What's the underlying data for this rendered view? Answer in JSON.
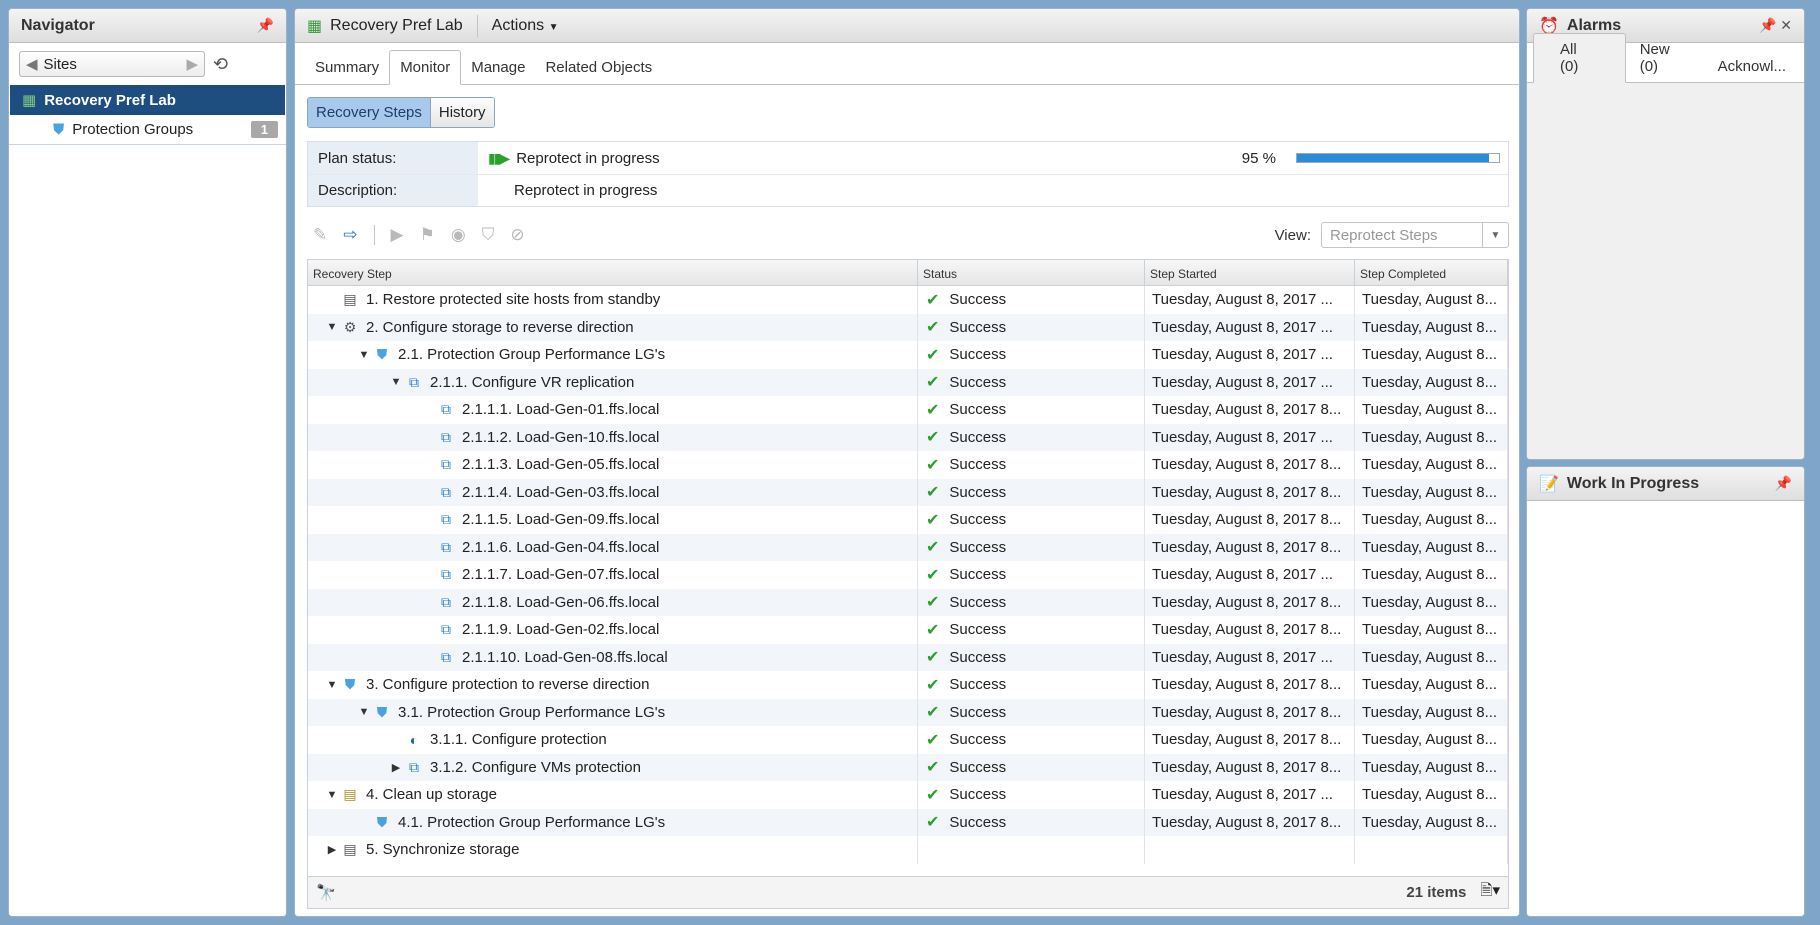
{
  "navigator": {
    "title": "Navigator",
    "sites_label": "Sites",
    "selected_item": "Recovery Pref Lab",
    "items": [
      {
        "label": "Protection Groups",
        "count": "1"
      }
    ]
  },
  "main": {
    "title": "Recovery Pref Lab",
    "actions_label": "Actions",
    "tabs": [
      "Summary",
      "Monitor",
      "Manage",
      "Related Objects"
    ],
    "subtabs": [
      "Recovery Steps",
      "History"
    ],
    "plan_status_label": "Plan status:",
    "plan_status_value": "Reprotect in progress",
    "description_label": "Description:",
    "description_value": "Reprotect in progress",
    "progress": {
      "label": "95 %",
      "fraction": 0.95
    },
    "view_label": "View:",
    "view_value": "Reprotect Steps",
    "columns": [
      "Recovery Step",
      "Status",
      "Step Started",
      "Step Completed"
    ],
    "items_count": "21 items",
    "rows": [
      {
        "level": 0,
        "toggle": "",
        "icon": "host",
        "name": "1. Restore protected site hosts from standby",
        "status": "Success",
        "started": "Tuesday, August 8, 2017 ...",
        "completed": "Tuesday, August 8..."
      },
      {
        "level": 0,
        "toggle": "down",
        "icon": "gear",
        "name": "2. Configure storage to reverse direction",
        "status": "Success",
        "started": "Tuesday, August 8, 2017 ...",
        "completed": "Tuesday, August 8..."
      },
      {
        "level": 1,
        "toggle": "down",
        "icon": "shield",
        "name": "2.1. Protection Group Performance LG's",
        "status": "Success",
        "started": "Tuesday, August 8, 2017 ...",
        "completed": "Tuesday, August 8..."
      },
      {
        "level": 2,
        "toggle": "down",
        "icon": "vm",
        "name": "2.1.1. Configure VR replication",
        "status": "Success",
        "started": "Tuesday, August 8, 2017 ...",
        "completed": "Tuesday, August 8..."
      },
      {
        "level": 3,
        "toggle": "",
        "icon": "vm",
        "name": "2.1.1.1. Load-Gen-01.ffs.local",
        "status": "Success",
        "started": "Tuesday, August 8, 2017 8...",
        "completed": "Tuesday, August 8..."
      },
      {
        "level": 3,
        "toggle": "",
        "icon": "vm",
        "name": "2.1.1.2. Load-Gen-10.ffs.local",
        "status": "Success",
        "started": "Tuesday, August 8, 2017 ...",
        "completed": "Tuesday, August 8..."
      },
      {
        "level": 3,
        "toggle": "",
        "icon": "vm",
        "name": "2.1.1.3. Load-Gen-05.ffs.local",
        "status": "Success",
        "started": "Tuesday, August 8, 2017 8...",
        "completed": "Tuesday, August 8..."
      },
      {
        "level": 3,
        "toggle": "",
        "icon": "vm",
        "name": "2.1.1.4. Load-Gen-03.ffs.local",
        "status": "Success",
        "started": "Tuesday, August 8, 2017 8...",
        "completed": "Tuesday, August 8..."
      },
      {
        "level": 3,
        "toggle": "",
        "icon": "vm",
        "name": "2.1.1.5. Load-Gen-09.ffs.local",
        "status": "Success",
        "started": "Tuesday, August 8, 2017 8...",
        "completed": "Tuesday, August 8..."
      },
      {
        "level": 3,
        "toggle": "",
        "icon": "vm",
        "name": "2.1.1.6. Load-Gen-04.ffs.local",
        "status": "Success",
        "started": "Tuesday, August 8, 2017 8...",
        "completed": "Tuesday, August 8..."
      },
      {
        "level": 3,
        "toggle": "",
        "icon": "vm",
        "name": "2.1.1.7. Load-Gen-07.ffs.local",
        "status": "Success",
        "started": "Tuesday, August 8, 2017 ...",
        "completed": "Tuesday, August 8..."
      },
      {
        "level": 3,
        "toggle": "",
        "icon": "vm",
        "name": "2.1.1.8. Load-Gen-06.ffs.local",
        "status": "Success",
        "started": "Tuesday, August 8, 2017 8...",
        "completed": "Tuesday, August 8..."
      },
      {
        "level": 3,
        "toggle": "",
        "icon": "vm",
        "name": "2.1.1.9. Load-Gen-02.ffs.local",
        "status": "Success",
        "started": "Tuesday, August 8, 2017 8...",
        "completed": "Tuesday, August 8..."
      },
      {
        "level": 3,
        "toggle": "",
        "icon": "vm",
        "name": "2.1.1.10. Load-Gen-08.ffs.local",
        "status": "Success",
        "started": "Tuesday, August 8, 2017 ...",
        "completed": "Tuesday, August 8..."
      },
      {
        "level": 0,
        "toggle": "down",
        "icon": "shield",
        "name": "3. Configure protection to reverse direction",
        "status": "Success",
        "started": "Tuesday, August 8, 2017 8...",
        "completed": "Tuesday, August 8..."
      },
      {
        "level": 1,
        "toggle": "down",
        "icon": "shield",
        "name": "3.1. Protection Group Performance LG's",
        "status": "Success",
        "started": "Tuesday, August 8, 2017 8...",
        "completed": "Tuesday, August 8..."
      },
      {
        "level": 2,
        "toggle": "",
        "icon": "blue",
        "name": "3.1.1. Configure protection",
        "status": "Success",
        "started": "Tuesday, August 8, 2017 8...",
        "completed": "Tuesday, August 8..."
      },
      {
        "level": 2,
        "toggle": "right",
        "icon": "vm",
        "name": "3.1.2. Configure VMs protection",
        "status": "Success",
        "started": "Tuesday, August 8, 2017 8...",
        "completed": "Tuesday, August 8..."
      },
      {
        "level": 0,
        "toggle": "down",
        "icon": "gold",
        "name": "4. Clean up storage",
        "status": "Success",
        "started": "Tuesday, August 8, 2017 ...",
        "completed": "Tuesday, August 8..."
      },
      {
        "level": 1,
        "toggle": "",
        "icon": "shield",
        "name": "4.1. Protection Group Performance LG's",
        "status": "Success",
        "started": "Tuesday, August 8, 2017 8...",
        "completed": "Tuesday, August 8..."
      },
      {
        "level": 0,
        "toggle": "right",
        "icon": "host",
        "name": "5. Synchronize storage",
        "status": "",
        "started": "",
        "completed": ""
      }
    ]
  },
  "alarms": {
    "title": "Alarms",
    "tabs": [
      "All (0)",
      "New (0)",
      "Acknowl..."
    ]
  },
  "work_in_progress": {
    "title": "Work In Progress"
  },
  "colors": {
    "selected_nav": "#1d4e7f",
    "success": "#2aa12a",
    "progress": "#2c8bd7"
  }
}
